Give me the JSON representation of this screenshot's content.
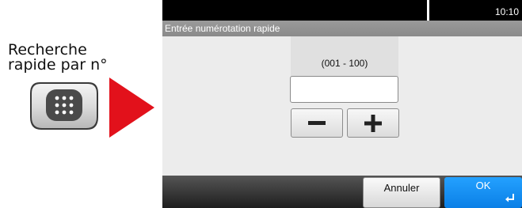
{
  "callout": {
    "line1": "Recherche",
    "line2": "rapide par n°",
    "key_icon": "keypad-icon",
    "arrow_color": "#e2111b"
  },
  "status": {
    "time": "10:10"
  },
  "dialog": {
    "title": "Entrée numérotation rapide",
    "range_label": "(001 - 100)",
    "number_value": "",
    "minus_icon": "minus-icon",
    "plus_icon": "plus-icon"
  },
  "footer": {
    "cancel_label": "Annuler",
    "ok_label": "OK",
    "ok_color": "#1a8ff3",
    "enter_icon": "enter-icon"
  }
}
